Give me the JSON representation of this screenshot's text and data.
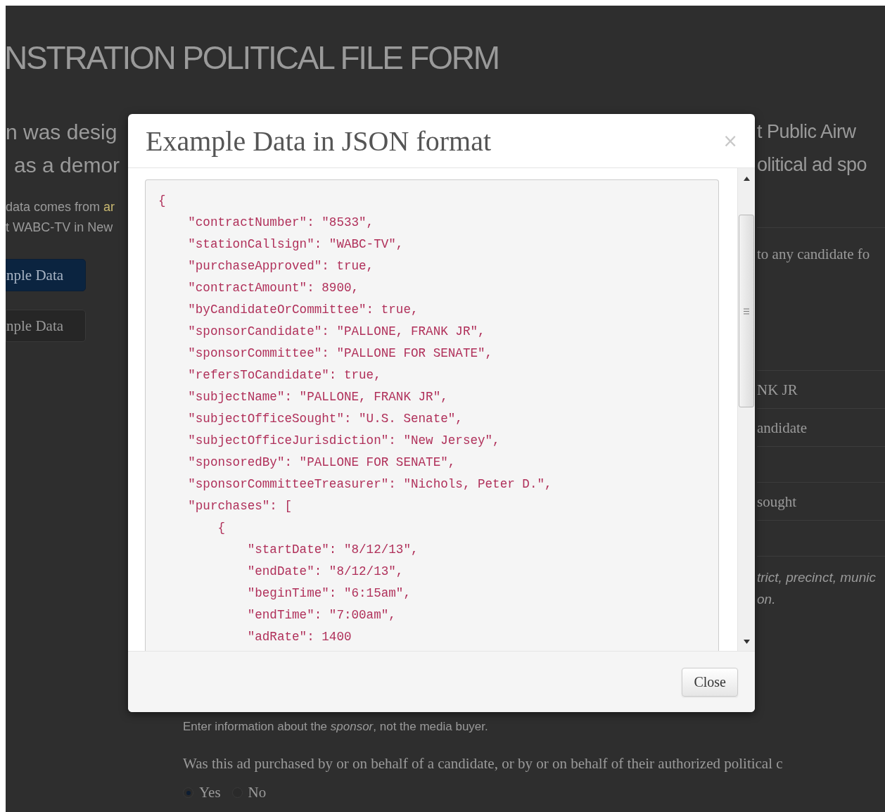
{
  "page": {
    "heading": "NSTRATION POLITICAL FILE FORM",
    "left": {
      "intro": [
        "n was desig",
        "as a demor"
      ],
      "source": [
        {
          "text": "data comes from ",
          "link": "ar"
        },
        {
          "text": "t WABC-TV in New"
        }
      ],
      "buttons": [
        {
          "label": "nple Data",
          "kind": "primary"
        },
        {
          "label": "nple Data",
          "kind": "default"
        }
      ]
    },
    "right": {
      "intro": [
        "t Public Airw",
        "olitical ad spo"
      ],
      "question": "to any candidate fo",
      "rows": [
        {
          "text": "NK JR",
          "kind": "value"
        },
        {
          "text": "andidate",
          "kind": "value"
        },
        {
          "kind": "blank"
        },
        {
          "text": "sought",
          "kind": "value"
        },
        {
          "kind": "blank"
        }
      ],
      "hint": [
        "trict, precinct, munic",
        "on."
      ]
    },
    "bottom": {
      "note": "Enter information about the *sponsor*, not the media buyer.",
      "question": "Was this ad purchased by or on behalf of a candidate, or by or on behalf of their authorized political c",
      "options": [
        {
          "label": "Yes",
          "selected": true
        },
        {
          "label": "No",
          "selected": false
        }
      ]
    }
  },
  "modal": {
    "title": "Example Data in JSON format",
    "close_symbol": "×",
    "code_lines": [
      "{",
      "    \"contractNumber\": \"8533\",",
      "    \"stationCallsign\": \"WABC-TV\",",
      "    \"purchaseApproved\": true,",
      "    \"contractAmount\": 8900,",
      "    \"byCandidateOrCommittee\": true,",
      "    \"sponsorCandidate\": \"PALLONE, FRANK JR\",",
      "    \"sponsorCommittee\": \"PALLONE FOR SENATE\",",
      "    \"refersToCandidate\": true,",
      "    \"subjectName\": \"PALLONE, FRANK JR\",",
      "    \"subjectOfficeSought\": \"U.S. Senate\",",
      "    \"subjectOfficeJurisdiction\": \"New Jersey\",",
      "    \"sponsoredBy\": \"PALLONE FOR SENATE\",",
      "    \"sponsorCommitteeTreasurer\": \"Nichols, Peter D.\",",
      "    \"purchases\": [",
      "        {",
      "            \"startDate\": \"8/12/13\",",
      "            \"endDate\": \"8/12/13\",",
      "            \"beginTime\": \"6:15am\",",
      "            \"endTime\": \"7:00am\",",
      "            \"adRate\": 1400"
    ],
    "close_button": "Close"
  }
}
